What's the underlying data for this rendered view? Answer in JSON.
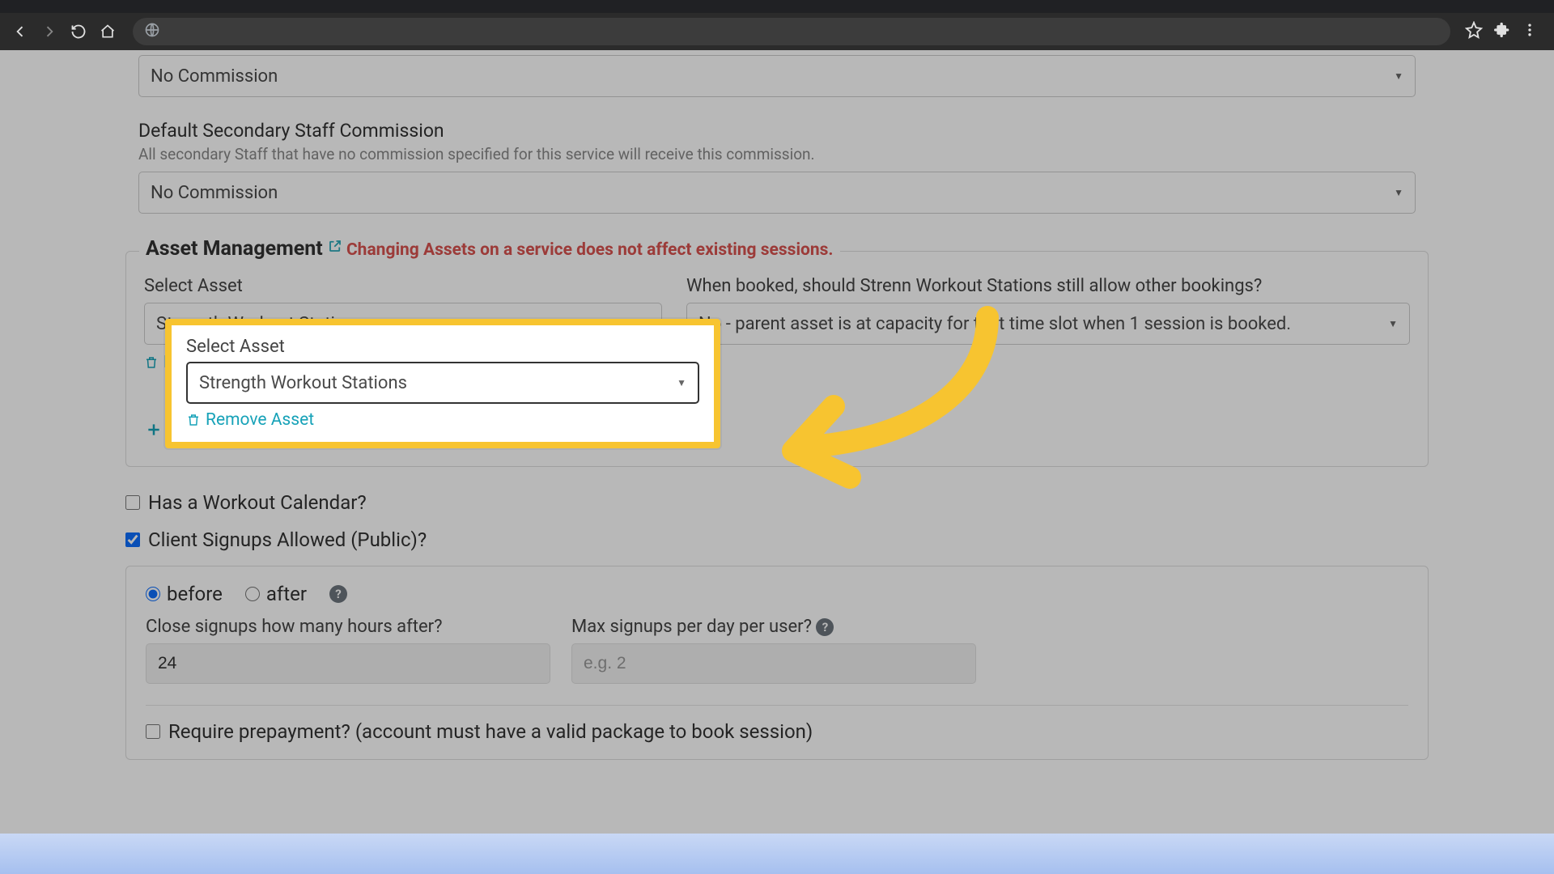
{
  "browser": {
    "star_tip": "Bookmark",
    "ext_tip": "Extensions",
    "menu_tip": "Menu"
  },
  "commission1": {
    "value": "No Commission"
  },
  "secondary_commission": {
    "title": "Default Secondary Staff Commission",
    "hint": "All secondary Staff that have no commission specified for this service will receive this commission.",
    "value": "No Commission"
  },
  "asset_mgmt": {
    "title": "Asset Management",
    "warning": "Changing Assets on a service does not affect existing sessions.",
    "select_label": "Select Asset",
    "select_value": "Strength Workout Stations",
    "remove_label": "Remove Asset",
    "booking_q_prefix": "When booked, should Stren",
    "booking_q_suffix": "n Workout Stations still allow other bookings?",
    "booking_value": "No - parent asset is at capacity for that time slot when 1 session is booked.",
    "add_label": "Add Asset"
  },
  "workout_cal": {
    "label": "Has a Workout Calendar?"
  },
  "client_signups": {
    "label": "Client Signups Allowed (Public)?"
  },
  "signup_panel": {
    "before": "before",
    "after": "after",
    "close_label": "Close signups how many hours after?",
    "close_value": "24",
    "max_label": "Max signups per day per user?",
    "max_placeholder": "e.g. 2",
    "prepay_label": "Require prepayment? (account must have a valid package to book session)"
  },
  "colors": {
    "accent": "#17a2b8",
    "danger": "#d9534f",
    "highlight": "#f7c430"
  }
}
